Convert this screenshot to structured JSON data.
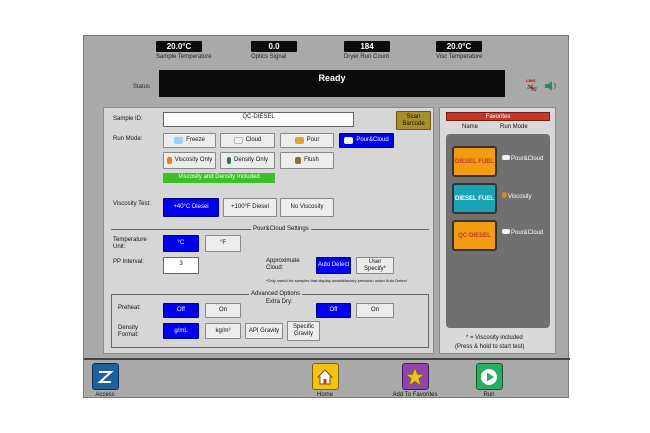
{
  "header": {
    "readouts": [
      {
        "value": "20.0°C",
        "label": "Sample Temperature"
      },
      {
        "value": "0.0",
        "label": "Optics Signal"
      },
      {
        "value": "184",
        "label": "Dryer Run Count"
      },
      {
        "value": "20.0°C",
        "label": "Visc Temperature"
      }
    ],
    "status_label": "Status",
    "status_value": "Ready",
    "lims_label": "LIMS"
  },
  "form": {
    "sample_id_label": "Sample ID:",
    "sample_id_value": "QC-DIESEL",
    "scan_barcode": "Scan Barcode",
    "run_mode_label": "Run Mode:",
    "run_modes": [
      "Freeze",
      "Cloud",
      "Pour",
      "Pour&Cloud",
      "Viscosity Only",
      "Density Only",
      "Flush"
    ],
    "included_banner": "Viscosity and Density Included",
    "viscosity_test_label": "Viscosity Test:",
    "viscosity_tests": [
      "+40°C Diesel",
      "+100°F Diesel",
      "No Viscosity"
    ],
    "pourcloud_section": "Pour&Cloud Settings",
    "temp_unit_label": "Temperature Unit:",
    "temp_units": [
      "°C",
      "°F"
    ],
    "pp_interval_label": "PP Interval:",
    "pp_interval_value": "3",
    "approx_cloud_label": "Approximate Cloud:",
    "approx_cloud_options": [
      "Auto Detect",
      "User Specify*"
    ],
    "approx_note": "*Only useful for samples that display unsatisfactory precision under Auto Detect",
    "advanced_section": "Advanced Options",
    "preheat_label": "Preheat:",
    "preheat_options": [
      "Off",
      "On"
    ],
    "extra_dry_label": "Extra Dry:",
    "extra_dry_options": [
      "Off",
      "On"
    ],
    "density_format_label": "Density Format:",
    "density_formats": [
      "g/mL",
      "kg/m³",
      "API Gravity",
      "Specific Gravity"
    ]
  },
  "favorites": {
    "title": "Favorites",
    "col_name": "Name",
    "col_mode": "Run Mode",
    "items": [
      {
        "name": "DIESEL FUEL",
        "mode": "Pour&Cloud",
        "color": "#f39c12"
      },
      {
        "name": "DIESEL FUEL",
        "mode": "Viscosity",
        "color": "#1aa3b5"
      },
      {
        "name": "QC-DIESEL",
        "mode": "Pour&Cloud",
        "color": "#f39c12"
      }
    ],
    "note": "* = Viscosity included",
    "hint": "(Press & hold to start test)"
  },
  "bottom": {
    "access": "Access",
    "home": "Home",
    "add_favorites": "Add To Favorites",
    "run": "Run"
  },
  "colors": {
    "selected": "#0000ee",
    "banner": "#39c126",
    "favorites_header": "#c0392b"
  }
}
